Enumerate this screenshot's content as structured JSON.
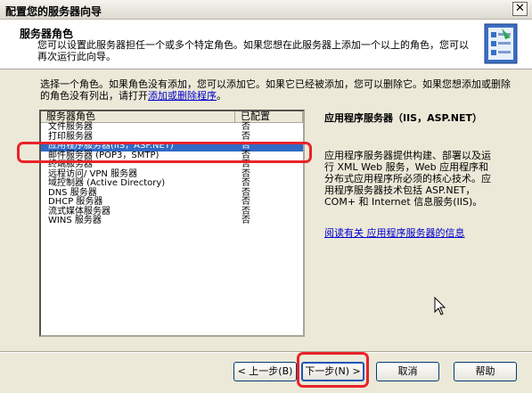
{
  "window": {
    "title": "配置您的服务器向导",
    "close_symbol": "✕"
  },
  "header": {
    "title": "服务器角色",
    "description": "您可以设置此服务器担任一个或多个特定角色。如果您想在此服务器上添加一个以上的角色，您可以再次运行此向导。"
  },
  "intro": {
    "text": "选择一个角色。如果角色没有添加，您可以添加它。如果它已经被添加，您可以删除它。如果您想添加或删除的角色没有列出，请打开",
    "link": "添加或删除程序",
    "suffix": "。"
  },
  "roles_list": {
    "columns": [
      "服务器角色",
      "已配置"
    ],
    "rows": [
      {
        "name": "文件服务器",
        "configured": "否"
      },
      {
        "name": "打印服务器",
        "configured": "否"
      },
      {
        "name": "应用程序服务器(IIS，ASP.NET)",
        "configured": "否",
        "selected": true
      },
      {
        "name": "邮件服务器 (POP3，SMTP)",
        "configured": "否"
      },
      {
        "name": "终端服务器",
        "configured": "否"
      },
      {
        "name": "远程访问/ VPN 服务器",
        "configured": "否"
      },
      {
        "name": "域控制器 (Active Directory)",
        "configured": "否"
      },
      {
        "name": "DNS 服务器",
        "configured": "否"
      },
      {
        "name": "DHCP 服务器",
        "configured": "否"
      },
      {
        "name": "流式媒体服务器",
        "configured": "否"
      },
      {
        "name": "WINS 服务器",
        "configured": "否"
      }
    ]
  },
  "detail": {
    "title": "应用程序服务器（IIS，ASP.NET）",
    "description": "应用程序服务器提供构建、部署以及运行 XML Web 服务，Web 应用程序和分布式应用程序所必须的核心技术。应用程序服务器技术包括 ASP.NET，COM+ 和 Internet 信息服务(IIS)。",
    "link": "阅读有关 应用程序服务器的信息"
  },
  "buttons": {
    "back": "< 上一步(B)",
    "next": "下一步(N) >",
    "cancel": "取消",
    "help": "帮助"
  },
  "colors": {
    "highlight": "#e8232a",
    "selection": "#316ac5",
    "link": "#0000cc"
  }
}
